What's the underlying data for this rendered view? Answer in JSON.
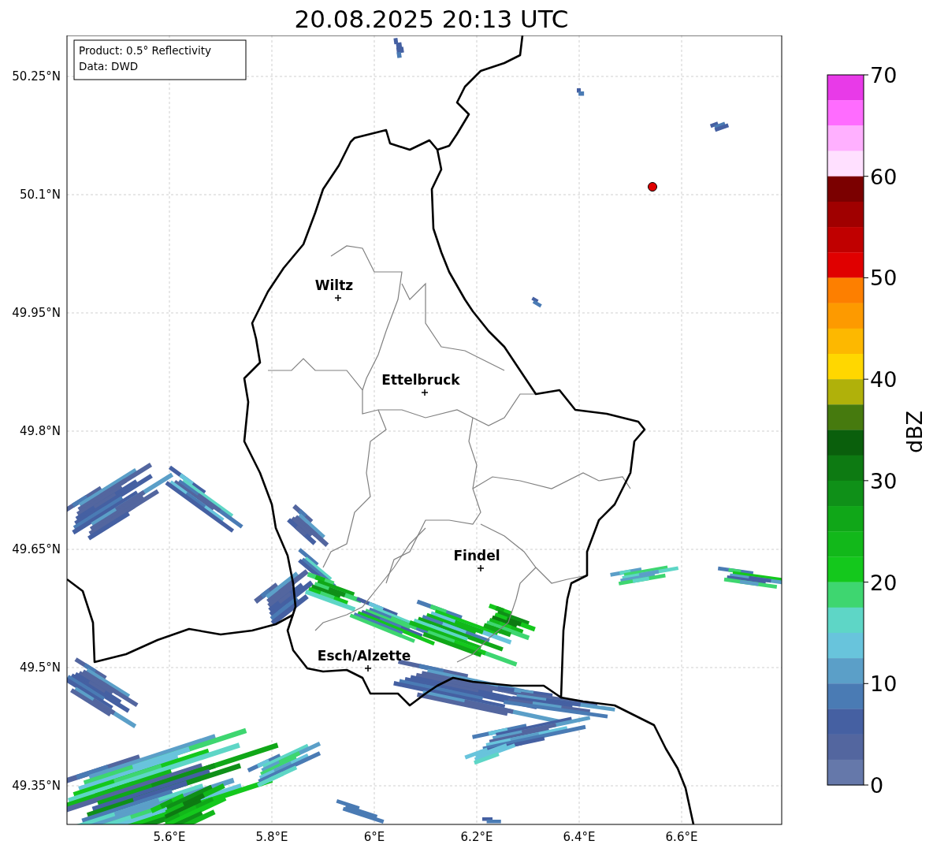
{
  "title": "20.08.2025 20:13 UTC",
  "info_box": {
    "lines": [
      "Product: 0.5° Reflectivity",
      "Data: DWD"
    ]
  },
  "map": {
    "lat_ticks": [
      "50.25°N",
      "50.1°N",
      "49.95°N",
      "49.8°N",
      "49.65°N",
      "49.5°N",
      "49.35°N"
    ],
    "lon_ticks": [
      "5.6°E",
      "5.8°E",
      "6°E",
      "6.2°E",
      "6.4°E",
      "6.6°E"
    ],
    "cities": [
      {
        "name": "Wiltz"
      },
      {
        "name": "Ettelbruck"
      },
      {
        "name": "Findel"
      },
      {
        "name": "Esch/Alzette"
      }
    ]
  },
  "colorbar": {
    "label": "dBZ",
    "ticks": [
      "70",
      "60",
      "50",
      "40",
      "30",
      "20",
      "10",
      "0"
    ],
    "segments": [
      {
        "color": "#e83ae8"
      },
      {
        "color": "#ff6cff"
      },
      {
        "color": "#ffb0ff"
      },
      {
        "color": "#ffe0ff"
      },
      {
        "color": "#7b0000"
      },
      {
        "color": "#a00000"
      },
      {
        "color": "#c00000"
      },
      {
        "color": "#e00000"
      },
      {
        "color": "#fd7f00"
      },
      {
        "color": "#fd9a00"
      },
      {
        "color": "#fdb800"
      },
      {
        "color": "#ffd700"
      },
      {
        "color": "#b0b10a"
      },
      {
        "color": "#467a0e"
      },
      {
        "color": "#0a5f0c"
      },
      {
        "color": "#0d7a12"
      },
      {
        "color": "#0f9018"
      },
      {
        "color": "#10a718"
      },
      {
        "color": "#12b81a"
      },
      {
        "color": "#14c81c"
      },
      {
        "color": "#3ed670"
      },
      {
        "color": "#5ed6c6"
      },
      {
        "color": "#68c4dc"
      },
      {
        "color": "#5b9fc8"
      },
      {
        "color": "#4a7bb4"
      },
      {
        "color": "#4560a2"
      },
      {
        "color": "#53669f"
      },
      {
        "color": "#6578aa"
      }
    ]
  }
}
